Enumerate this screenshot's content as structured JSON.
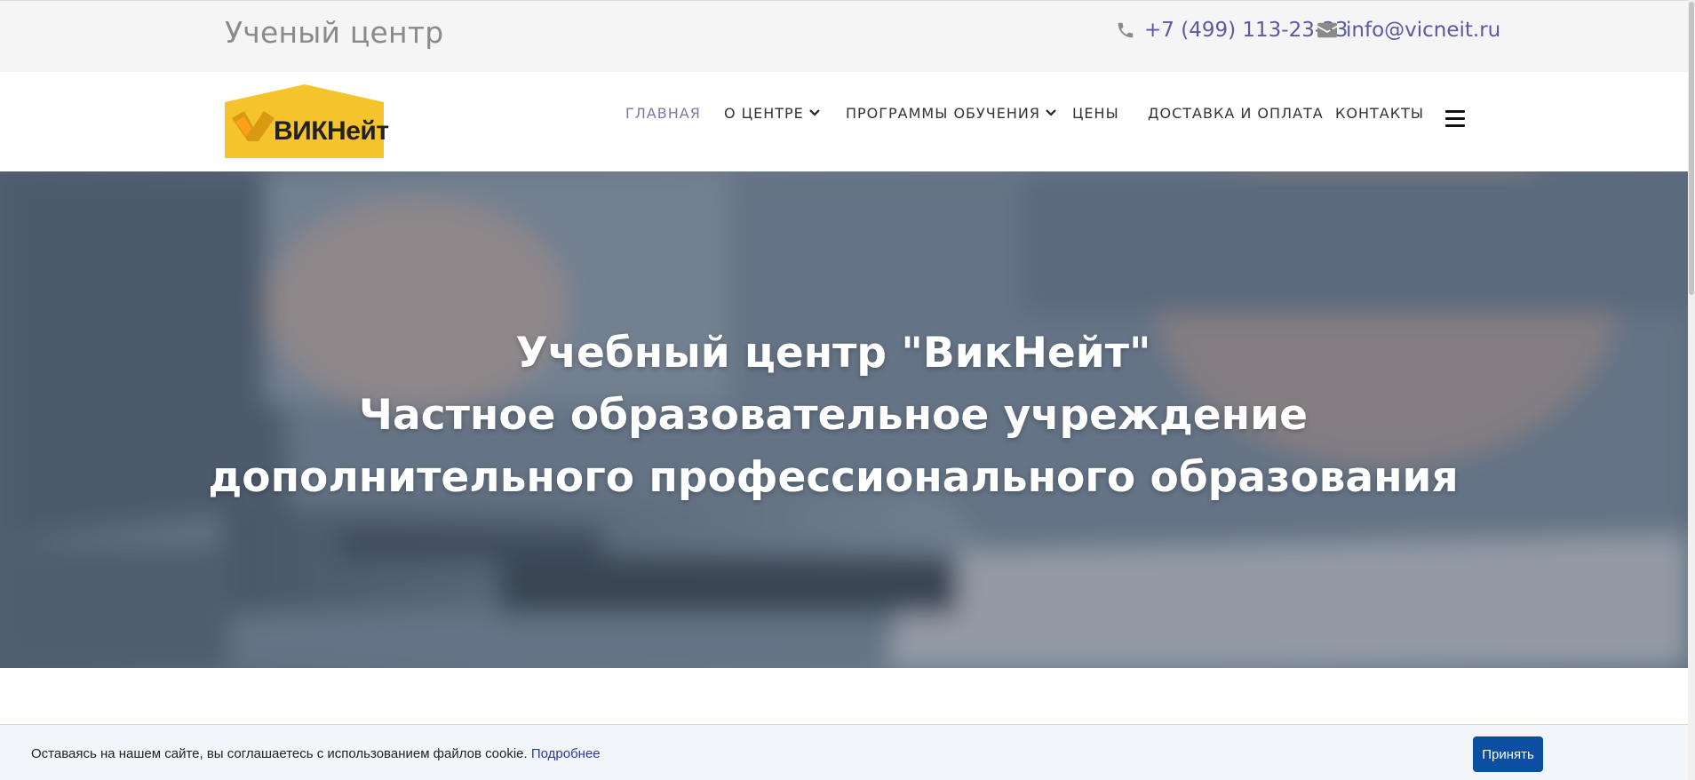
{
  "topbar": {
    "site_title": "Ученый центр",
    "phone": "+7 (499) 113-23-33",
    "email": "info@vicneit.ru",
    "phone_icon": "phone-icon",
    "email_icon": "envelope-icon"
  },
  "header": {
    "logo_text": "ВИКНейт",
    "nav": [
      {
        "label": "ГЛАВНАЯ",
        "active": true,
        "dropdown": false
      },
      {
        "label": "О ЦЕНТРЕ",
        "active": false,
        "dropdown": true
      },
      {
        "label": "ПРОГРАММЫ ОБУЧЕНИЯ",
        "active": false,
        "dropdown": true
      },
      {
        "label": "ЦЕНЫ",
        "active": false,
        "dropdown": false
      },
      {
        "label": "ДОСТАВКА И ОПЛАТА",
        "active": false,
        "dropdown": false
      },
      {
        "label": "КОНТАКТЫ",
        "active": false,
        "dropdown": false
      }
    ],
    "menu_icon": "hamburger-menu-icon"
  },
  "hero": {
    "line1": "Учебный центр \"ВикНейт\"",
    "line2": "Частное образовательное учреждение",
    "line3": "дополнительного профессионального образования"
  },
  "cookie": {
    "text": "Оставаясь на нашем сайте, вы соглашаетесь с использованием файлов cookie.",
    "link": "Подробнее",
    "accept": "Принять"
  },
  "colors": {
    "accent": "#5a5aa0",
    "logo_yellow": "#f5c32c",
    "button_blue": "#0b4fa2"
  }
}
